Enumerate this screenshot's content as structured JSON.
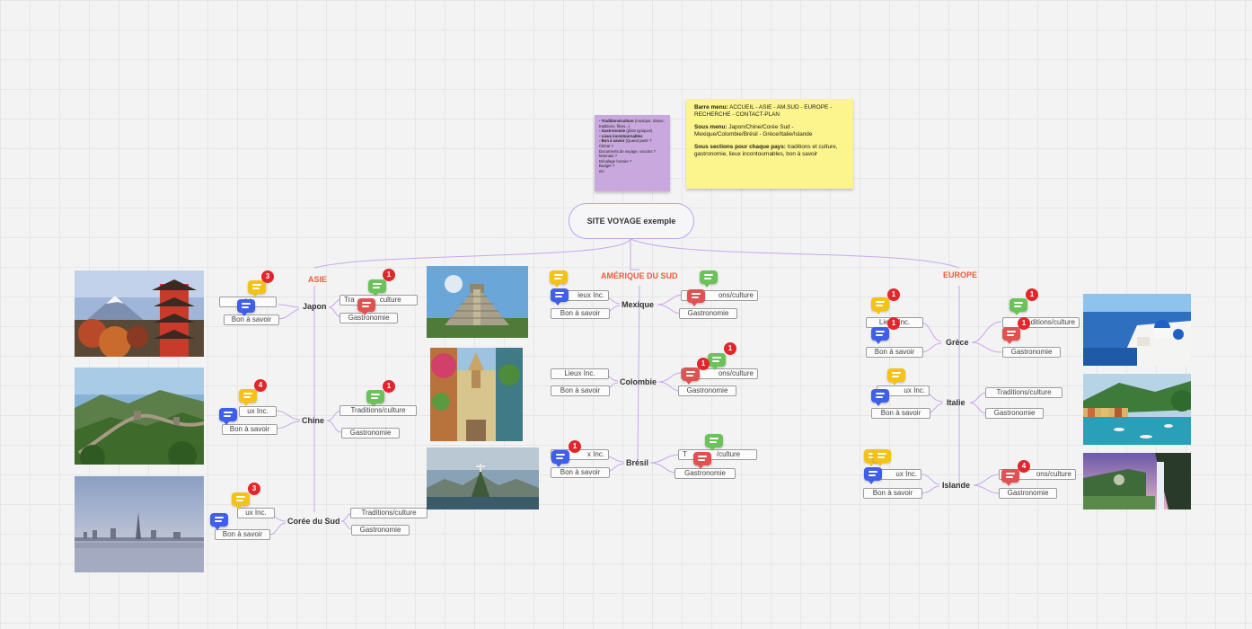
{
  "root": {
    "title": "SITE VOYAGE exemple"
  },
  "regions": {
    "asie": "ASIE",
    "amerique": "AMÉRIQUE DU SUD",
    "europe": "EUROPE"
  },
  "countries": {
    "japon": "Japon",
    "chine": "Chine",
    "coree": "Corée du Sud",
    "mexique": "Mexique",
    "colombie": "Colombie",
    "bresil": "Brésil",
    "grece": "Grèce",
    "italie": "Italie",
    "islande": "Islande"
  },
  "labels": {
    "lieux": "Lieux Inc.",
    "bon_a_savoir": "Bon à savoir",
    "traditions": "Traditions/culture",
    "gastronomie": "Gastronomie",
    "lieux_frag_1": "Li",
    "lieux_frag_2": "ux Inc.",
    "lieux_frag_3": "Lieux Inc.",
    "lieux_frag_4": "ieux Inc.",
    "lieux_frag_5": "x Inc.",
    "trad_frag_1": "Tra",
    "trad_frag_2": "culture",
    "trad_frag_3": "ons/culture",
    "trad_frag_4": "T",
    "trad_frag_5": "/culture",
    "trad_frag_6": "ditions/culture"
  },
  "badges": {
    "japon_yellow": "3",
    "japon_green": "1",
    "chine_yellow": "4",
    "chine_green": "1",
    "coree_yellow": "3",
    "colombie_green": "1",
    "colombie_red": "1",
    "bresil_blue": "1",
    "grece_yellow": "1",
    "grece_blue": "1",
    "grece_green": "1",
    "grece_red": "1",
    "islande_red": "4"
  },
  "sticky_purple": {
    "l1_bold": "- Traditions/culture",
    "l1": " (musique, danse, traditions, fêtes...)",
    "l2_bold": "- Gastronomie",
    "l2": " (plats typiques)",
    "l3_bold": "- Lieux incontournables",
    "l4_bold": "- Bon à savoir",
    "l4": " (Quand partir ?",
    "l5": "Climat ?",
    "l6": "Documents de voyage, vaccins ?",
    "l7": "Monnaie ?",
    "l8": "Décalage horaire ?",
    "l9": "Budget ?",
    "l10": "etc"
  },
  "sticky_yellow": {
    "menu_bold": "Barre menu:",
    "menu": " ACCUEIL - ASIE - AM.SUD - EUROPE - RECHERCHE - CONTACT-PLAN",
    "submenu_bold": "Sous menu:",
    "submenu": " Japon/Chine/Corée Sud - Mexique/Colombie/Brésil - Grèce/Italie/Islande",
    "sections_bold": "Sous sections pour chaque pays:",
    "sections": " traditions et culture, gastronomie, lieux incontournables, bon à savoir"
  },
  "colors": {
    "yellow": "#f5c218",
    "green": "#6cc25a",
    "red": "#e05252",
    "blue": "#3f5fe8",
    "badge": "#e1262d",
    "region": "#ef5a3c",
    "connector": "#c9a6ee"
  },
  "icons": {
    "comment": "comment-bubble-icon",
    "photos": [
      "mount-fuji-pagoda",
      "great-wall",
      "seoul-skyline",
      "chichen-itza",
      "cartagena-street",
      "rio-christ-redeemer",
      "santorini",
      "portofino",
      "iceland-waterfall"
    ]
  }
}
